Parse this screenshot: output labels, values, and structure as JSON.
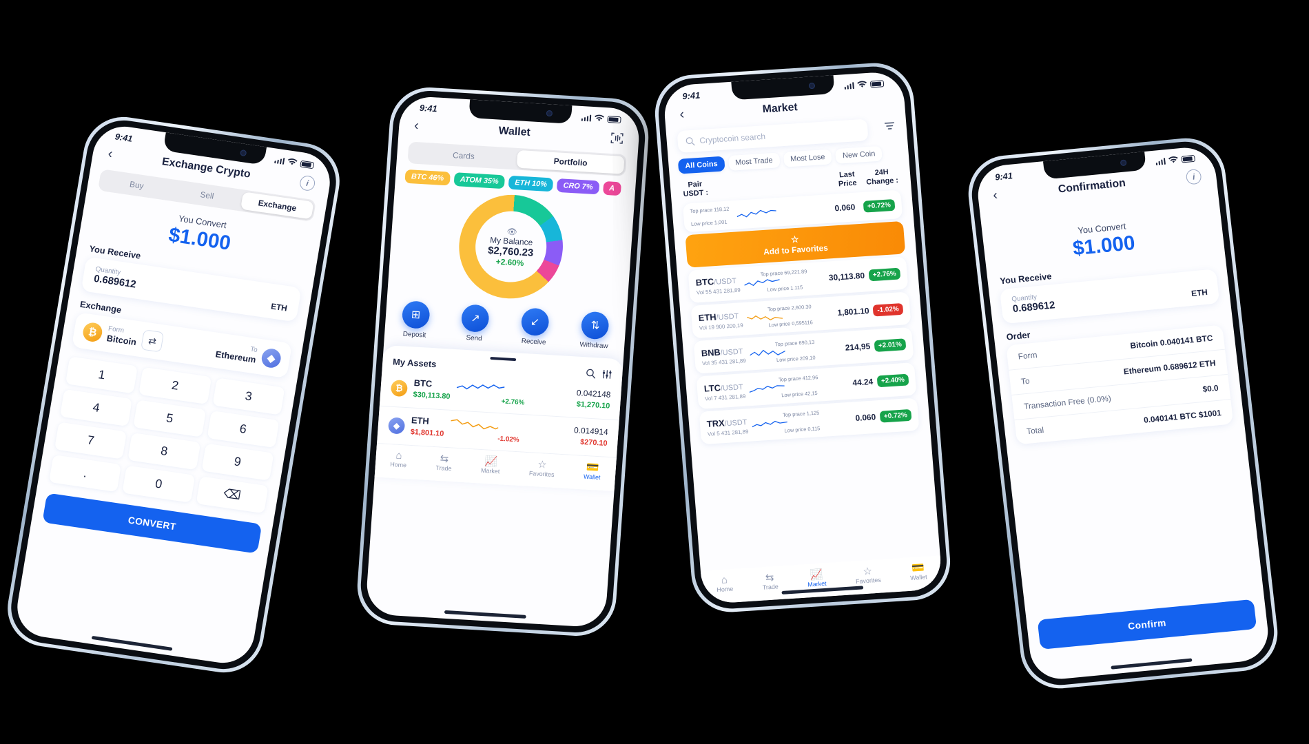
{
  "status_bar": {
    "time": "9:41"
  },
  "phone1": {
    "title": "Exchange Crypto",
    "back_icon": "chevron-left-icon",
    "info_icon": "info-icon",
    "tabs": [
      {
        "label": "Buy",
        "active": false
      },
      {
        "label": "Sell",
        "active": false
      },
      {
        "label": "Exchange",
        "active": true
      }
    ],
    "convert_label": "You Convert",
    "convert_amount": "$1.000",
    "receive_label": "You Receive",
    "quantity_label": "Quantity",
    "quantity_value": "0.689612",
    "quantity_currency": "ETH",
    "exchange_label": "Exchange",
    "from_label": "Form",
    "from_value": "Bitcoin",
    "to_label": "To",
    "to_value": "Ethereum",
    "swap_icon": "swap-arrows-icon",
    "keys": [
      "1",
      "2",
      "3",
      "4",
      "5",
      "6",
      "7",
      "8",
      "9",
      ".",
      "0",
      "⌫"
    ],
    "cta": "CONVERT"
  },
  "phone2": {
    "title": "Wallet",
    "scan_icon": "scan-icon",
    "tabs": [
      {
        "label": "Cards",
        "active": false
      },
      {
        "label": "Portfolio",
        "active": true
      }
    ],
    "chips": [
      {
        "label": "BTC 46%",
        "color": "#fbbf3c"
      },
      {
        "label": "ATOM 35%",
        "color": "#17c898"
      },
      {
        "label": "ETH 10%",
        "color": "#17b6d9"
      },
      {
        "label": "CRO 7%",
        "color": "#8b5cf6"
      },
      {
        "label": "A",
        "color": "#ec4899"
      }
    ],
    "balance_label": "My Balance",
    "balance_value": "$2,760.23",
    "balance_change": "+2.60%",
    "eye_icon": "eye-icon",
    "actions": [
      {
        "label": "Deposit",
        "icon": "plus-square-icon"
      },
      {
        "label": "Send",
        "icon": "arrow-up-right-icon"
      },
      {
        "label": "Receive",
        "icon": "arrow-down-left-icon"
      },
      {
        "label": "Withdraw",
        "icon": "bank-icon"
      }
    ],
    "assets_title": "My Assets",
    "search_icon": "search-icon",
    "filter_icon": "filter-icon",
    "assets": [
      {
        "symbol": "BTC",
        "price": "$30,113.80",
        "price_color": "#16a34a",
        "change": "+2.76%",
        "change_color": "#16a34a",
        "qty": "0.042148",
        "value": "$1,270.10",
        "value_color": "#16a34a",
        "coin_color": "btc"
      },
      {
        "symbol": "ETH",
        "price": "$1,801.10",
        "price_color": "#e0342c",
        "change": "-1.02%",
        "change_color": "#e0342c",
        "qty": "0.014914",
        "value": "$270.10",
        "value_color": "#e0342c",
        "coin_color": "eth"
      }
    ],
    "tabbar": [
      {
        "label": "Home",
        "icon": "home-icon",
        "active": false
      },
      {
        "label": "Trade",
        "icon": "trade-icon",
        "active": false
      },
      {
        "label": "Market",
        "icon": "chart-icon",
        "active": false
      },
      {
        "label": "Favorites",
        "icon": "star-icon",
        "active": false
      },
      {
        "label": "Wallet",
        "icon": "wallet-icon",
        "active": true
      }
    ]
  },
  "phone3": {
    "title": "Market",
    "back_icon": "chevron-left-icon",
    "filter_icon": "filter-icon",
    "search_placeholder": "Cryptocoin search",
    "search_icon": "search-icon",
    "filters": [
      {
        "label": "All Coins",
        "active": true
      },
      {
        "label": "Most Trade",
        "active": false
      },
      {
        "label": "Most Lose",
        "active": false
      },
      {
        "label": "New Coin",
        "active": false
      }
    ],
    "columns": [
      "Pair\nUSDT :",
      "Last\nPrice",
      "24H\nChange :"
    ],
    "col_pair": "Pair",
    "col_pair_sub": "USDT :",
    "col_last": "Last",
    "col_last_sub": "Price",
    "col_change": "24H",
    "col_change_sub": "Change :",
    "favorites_button": "Add to Favorites",
    "star_icon": "star-outline-icon",
    "top_row": {
      "top": "Top prace 118,12",
      "low": "Low price 1,001",
      "price": "0.060",
      "change": "+0.72%"
    },
    "rows": [
      {
        "pair": "BTC",
        "quote": "/USDT",
        "vol": "Vol 55 431 281,89",
        "top": "Top prace 69,221.89",
        "low": "Low price 1.115",
        "price": "30,113.80",
        "change": "+2.76%",
        "up": true
      },
      {
        "pair": "ETH",
        "quote": "/USDT",
        "vol": "Vol 19 900 200,19",
        "top": "Top prace 2,600.30",
        "low": "Low price 0,595116",
        "price": "1,801.10",
        "change": "-1.02%",
        "up": false
      },
      {
        "pair": "BNB",
        "quote": "/USDT",
        "vol": "Vol 35 431 281,89",
        "top": "Top prace 690,13",
        "low": "Low price 209,10",
        "price": "214,95",
        "change": "+2.01%",
        "up": true
      },
      {
        "pair": "LTC",
        "quote": "/USDT",
        "vol": "Vol 7 431 281,89",
        "top": "Top prace 412,96",
        "low": "Low price 42,15",
        "price": "44.24",
        "change": "+2.40%",
        "up": true
      },
      {
        "pair": "TRX",
        "quote": "/USDT",
        "vol": "Vol 5 431 281,89",
        "top": "Top prace 1,125",
        "low": "Low price 0,115",
        "price": "0.060",
        "change": "+0.72%",
        "up": true
      }
    ],
    "tabbar": [
      {
        "label": "Home",
        "icon": "home-icon",
        "active": false
      },
      {
        "label": "Trade",
        "icon": "trade-icon",
        "active": false
      },
      {
        "label": "Market",
        "icon": "chart-icon",
        "active": true
      },
      {
        "label": "Favorites",
        "icon": "star-icon",
        "active": false
      },
      {
        "label": "Wallet",
        "icon": "wallet-icon",
        "active": false
      }
    ]
  },
  "phone4": {
    "title": "Confirmation",
    "back_icon": "chevron-left-icon",
    "info_icon": "info-icon",
    "convert_label": "You Convert",
    "convert_amount": "$1.000",
    "receive_label": "You Receive",
    "quantity_label": "Quantity",
    "quantity_value": "0.689612",
    "quantity_currency": "ETH",
    "order_label": "Order",
    "order_rows": [
      {
        "key": "Form",
        "value": "Bitcoin 0.040141 BTC"
      },
      {
        "key": "To",
        "value": "Ethereum 0.689612 ETH"
      },
      {
        "key": "Transaction Free (0.0%)",
        "value": "$0.0"
      },
      {
        "key": "Total",
        "value": "0.040141 BTC $1001"
      }
    ],
    "cta": "Confirm"
  },
  "colors": {
    "accent": "#1462ef",
    "up": "#16a34a",
    "down": "#e0342c",
    "orange": "#f98a06"
  }
}
